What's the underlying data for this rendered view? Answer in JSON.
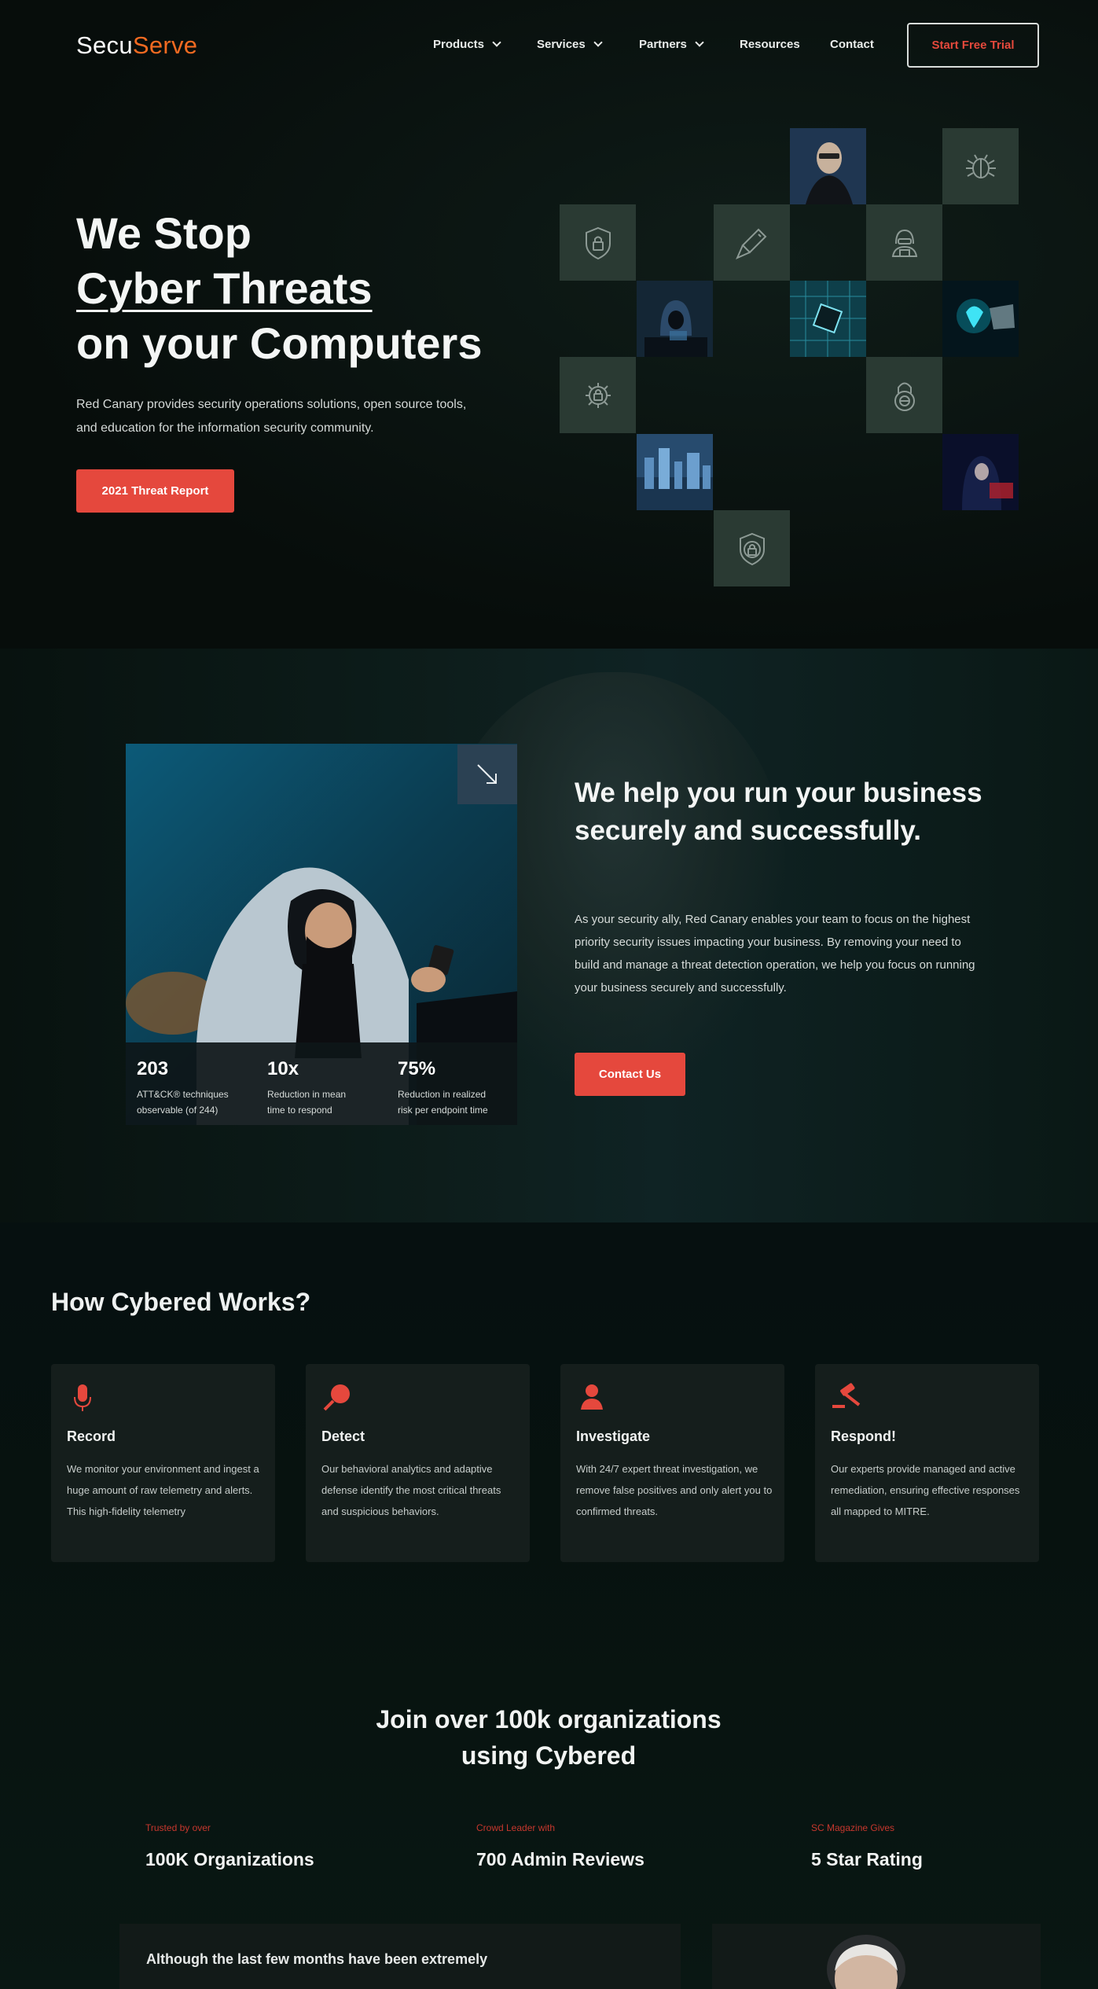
{
  "nav": {
    "logo_part1": "Secu",
    "logo_part2": "Serve",
    "items": [
      {
        "label": "Products",
        "has_dropdown": true
      },
      {
        "label": "Services",
        "has_dropdown": true
      },
      {
        "label": "Partners",
        "has_dropdown": true
      },
      {
        "label": "Resources",
        "has_dropdown": false
      },
      {
        "label": "Contact",
        "has_dropdown": false
      }
    ],
    "cta_label": "Start Free Trial"
  },
  "hero": {
    "title_line1": "We Stop",
    "title_line2": "Cyber Threats",
    "title_line3": "on your Computers",
    "description": "Red Canary provides security operations solutions, open source tools, and education for the information security community.",
    "button_label": "2021 Threat Report",
    "tiles": [
      {
        "kind": "photo",
        "subject": "man-with-glasses-photo"
      },
      {
        "kind": "icon",
        "icon": "bug-icon"
      },
      {
        "kind": "icon",
        "icon": "shield-lock-icon"
      },
      {
        "kind": "icon",
        "icon": "usb-key-icon"
      },
      {
        "kind": "icon",
        "icon": "hacker-icon"
      },
      {
        "kind": "photo",
        "subject": "hooded-hacker-photo"
      },
      {
        "kind": "photo",
        "subject": "circuit-chip-photo"
      },
      {
        "kind": "photo",
        "subject": "cyber-hand-photo"
      },
      {
        "kind": "icon",
        "icon": "virus-icon"
      },
      {
        "kind": "icon",
        "icon": "padlock-icon"
      },
      {
        "kind": "photo",
        "subject": "city-network-photo"
      },
      {
        "kind": "photo",
        "subject": "dark-hacker-photo"
      },
      {
        "kind": "icon",
        "icon": "shield-icon"
      }
    ]
  },
  "about": {
    "title": "We help you run your business securely and successfully.",
    "description": "As your security ally, Red Canary enables your team to focus on the highest priority security issues impacting your business. By removing your need to build and manage a threat detection operation, we help you focus on running your business securely and successfully.",
    "button_label": "Contact Us",
    "arrow_icon": "arrow-down-right-icon",
    "stats": [
      {
        "value": "203",
        "label": "ATT&CK® techniques observable (of 244)"
      },
      {
        "value": "10x",
        "label": "Reduction in mean time to respond"
      },
      {
        "value": "75%",
        "label": "Reduction in realized risk per endpoint time"
      }
    ]
  },
  "how": {
    "title": "How Cybered Works?",
    "cards": [
      {
        "icon": "microphone-icon",
        "title": "Record",
        "desc": "We monitor your environment and ingest a huge amount of raw telemetry and alerts. This high-fidelity telemetry"
      },
      {
        "icon": "magnifier-icon",
        "title": "Detect",
        "desc": "Our behavioral analytics and adaptive defense identify the most critical threats and suspicious behaviors."
      },
      {
        "icon": "investigator-icon",
        "title": "Investigate",
        "desc": "With 24/7 expert threat investigation, we remove false positives and only alert you to confirmed threats."
      },
      {
        "icon": "gavel-icon",
        "title": "Respond!",
        "desc": "Our experts provide managed and active remediation, ensuring effective responses all mapped to MITRE."
      }
    ]
  },
  "join": {
    "title_line1": "Join over 100k organizations",
    "title_line2": "using Cybered",
    "trust": [
      {
        "pre": "Trusted by over",
        "value": "100K Organizations"
      },
      {
        "pre": "Crowd Leader with",
        "value": "700 Admin Reviews"
      },
      {
        "pre": "SC Magazine Gives",
        "value": "5 Star Rating"
      }
    ],
    "testimonial": "Although the last few months have been extremely"
  },
  "colors": {
    "accent_red": "#e5483d",
    "logo_orange": "#f26a21",
    "background": "#07100e",
    "tile": "#2a3a33"
  }
}
